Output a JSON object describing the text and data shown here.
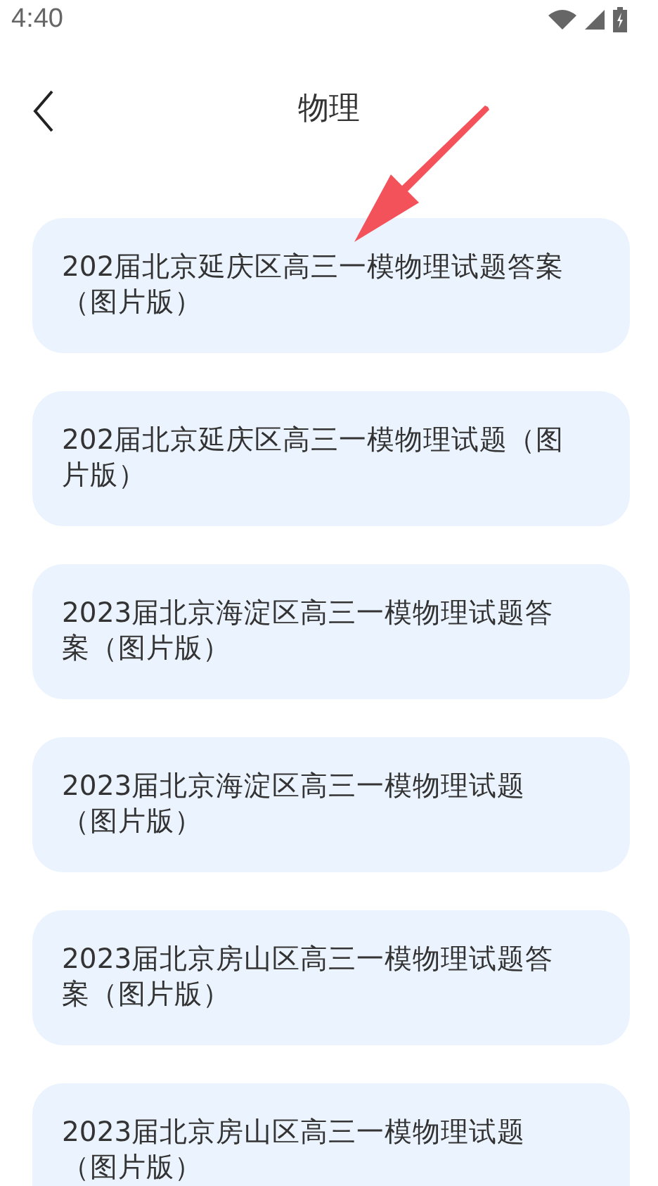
{
  "status_bar": {
    "time": "4:40"
  },
  "header": {
    "title": "物理"
  },
  "items": [
    {
      "lines": [
        "202届北京延庆区高三一模物理试题答案",
        "（图片版）"
      ]
    },
    {
      "lines": [
        "202届北京延庆区高三一模物理试题（图",
        "片版）"
      ]
    },
    {
      "lines": [
        "2023届北京海淀区高三一模物理试题答",
        "案（图片版）"
      ]
    },
    {
      "lines": [
        "2023届北京海淀区高三一模物理试题",
        "（图片版）"
      ]
    },
    {
      "lines": [
        "2023届北京房山区高三一模物理试题答",
        "案（图片版）"
      ]
    },
    {
      "lines": [
        "2023届北京房山区高三一模物理试题",
        "（图片版）"
      ]
    }
  ]
}
